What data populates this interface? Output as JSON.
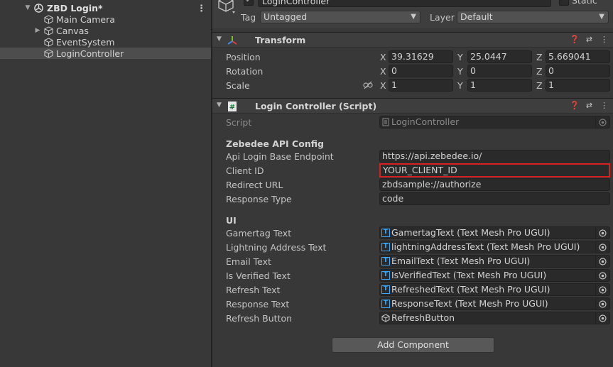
{
  "hierarchy": {
    "scene": "ZBD Login*",
    "items": [
      {
        "label": "Main Camera",
        "expandable": false
      },
      {
        "label": "Canvas",
        "expandable": true
      },
      {
        "label": "EventSystem",
        "expandable": false
      },
      {
        "label": "LoginController",
        "expandable": false,
        "selected": true
      }
    ],
    "menu_icon": "kebab-menu-icon"
  },
  "inspector": {
    "object_name": "LoginController",
    "active_check": "✓",
    "static_label": "Static",
    "tag_label": "Tag",
    "tag_value": "Untagged",
    "layer_label": "Layer",
    "layer_value": "Default",
    "transform": {
      "title": "Transform",
      "position_label": "Position",
      "rotation_label": "Rotation",
      "scale_label": "Scale",
      "axis_x": "X",
      "axis_y": "Y",
      "axis_z": "Z",
      "position": {
        "x": "39.31629",
        "y": "25.0447",
        "z": "5.669041"
      },
      "rotation": {
        "x": "0",
        "y": "0",
        "z": "0"
      },
      "scale": {
        "x": "1",
        "y": "1",
        "z": "1"
      }
    },
    "script_component": {
      "title": "Login Controller (Script)",
      "script_label": "Script",
      "script_value": "LoginController",
      "api_section": "Zebedee API Config",
      "api_fields": [
        {
          "label": "Api Login Base Endpoint",
          "value": "https://api.zebedee.io/"
        },
        {
          "label": "Client ID",
          "value": "YOUR_CLIENT_ID",
          "highlight": true
        },
        {
          "label": "Redirect URL",
          "value": "zbdsample://authorize"
        },
        {
          "label": "Response Type",
          "value": "code"
        }
      ],
      "ui_section": "UI",
      "ui_fields": [
        {
          "label": "Gamertag Text",
          "value": "GamertagText (Text Mesh Pro UGUI)",
          "icon": "T"
        },
        {
          "label": "Lightning Address Text",
          "value": "lightningAddressText (Text Mesh Pro UGUI)",
          "icon": "T"
        },
        {
          "label": "Email Text",
          "value": "EmailText (Text Mesh Pro UGUI)",
          "icon": "T"
        },
        {
          "label": "Is Verified Text",
          "value": "IsVerifiedText (Text Mesh Pro UGUI)",
          "icon": "T"
        },
        {
          "label": "Refresh Text",
          "value": "RefreshedText (Text Mesh Pro UGUI)",
          "icon": "T"
        },
        {
          "label": "Response Text",
          "value": "ResponseText (Text Mesh Pro UGUI)",
          "icon": "T"
        },
        {
          "label": "Refresh Button",
          "value": "RefreshButton",
          "icon": "cube"
        }
      ]
    },
    "add_component_label": "Add Component"
  }
}
